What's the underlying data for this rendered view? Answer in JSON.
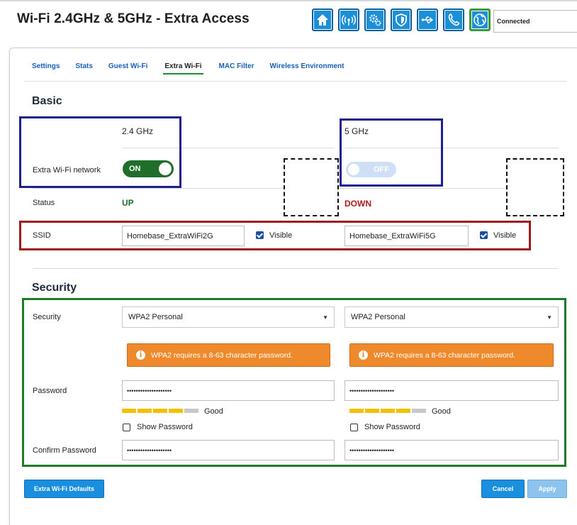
{
  "page_title": "Wi-Fi 2.4GHz & 5GHz - Extra Access",
  "top_icons": [
    "home-icon",
    "wireless-icon",
    "settings-gears-icon",
    "shield-icon",
    "usb-icon",
    "phone-icon",
    "globe-icon"
  ],
  "connection_status": "Connected",
  "tabs": [
    "Settings",
    "Stats",
    "Guest Wi-Fi",
    "Extra Wi-Fi",
    "MAC Filter",
    "Wireless Environment"
  ],
  "active_tab": "Extra Wi-Fi",
  "basic": {
    "title": "Basic",
    "col_24": "2.4 GHz",
    "col_5": "5 GHz",
    "network_label": "Extra Wi-Fi network",
    "toggle_24": "ON",
    "toggle_5": "OFF",
    "status_label": "Status",
    "status_24": "UP",
    "status_5": "DOWN",
    "ssid_label": "SSID",
    "ssid_24": "Homebase_ExtraWiFi2G",
    "ssid_5": "Homebase_ExtraWiFi5G",
    "visible_label": "Visible",
    "visible_24_checked": true,
    "visible_5_checked": true
  },
  "security": {
    "title": "Security",
    "security_label": "Security",
    "mode_24": "WPA2 Personal",
    "mode_5": "WPA2 Personal",
    "warning": "WPA2 requires a 8-63 character password.",
    "password_label": "Password",
    "password_24": "••••••••••••••••••••",
    "password_5": "••••••••••••••••••••",
    "strength_24": {
      "level": 4,
      "max": 5,
      "text": "Good"
    },
    "strength_5": {
      "level": 4,
      "max": 5,
      "text": "Good"
    },
    "show_password_label": "Show Password",
    "confirm_label": "Confirm Password",
    "confirm_24": "••••••••••••••••••••",
    "confirm_5": "••••••••••••••••••••"
  },
  "buttons": {
    "defaults": "Extra Wi-Fi Defaults",
    "cancel": "Cancel",
    "apply": "Apply"
  },
  "colors": {
    "accent_blue": "#1a8fe0",
    "status_up": "#1f6f2a",
    "status_down": "#b01a1a",
    "warning": "#ef8a2c",
    "annotation_blue": "#1b1f8f",
    "annotation_red": "#9e1a1a",
    "annotation_green": "#1f7a2a"
  }
}
